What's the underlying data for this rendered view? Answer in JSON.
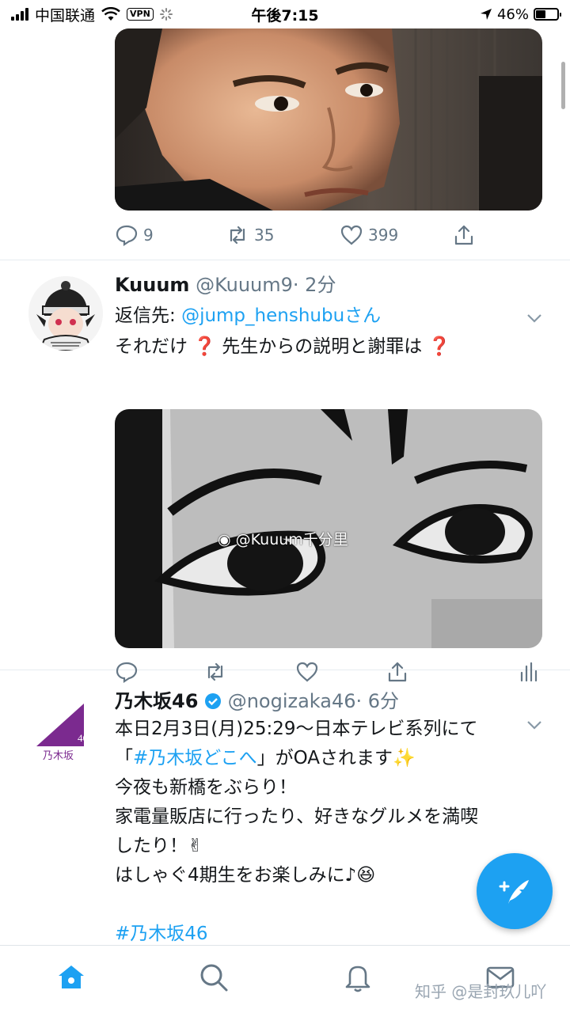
{
  "status_bar": {
    "carrier": "中国联通",
    "vpn": "VPN",
    "time": "午後7:15",
    "battery": "46%",
    "battery_level": 0.46
  },
  "tweets": [
    {
      "actions": {
        "reply_count": "9",
        "retweet_count": "35",
        "like_count": "399"
      }
    },
    {
      "name": "Kuuum",
      "handle": "@Kuuum9",
      "time": "· 2分",
      "reply_prefix": "返信先: ",
      "reply_to": "@jump_henshubuさん",
      "lines": [
        "それだけ ❓ 先生からの説明と謝罪は ❓"
      ],
      "media_watermark": "@Kuuum千分里"
    },
    {
      "name": "乃木坂46",
      "handle": "@nogizaka46",
      "time": "· 6分",
      "avatar_text_top": "46",
      "avatar_text_bottom": "乃木坂",
      "lines": [
        "本日2月3日(月)25:29〜日本テレビ系列にて",
        "「",
        "#乃木坂どこへ",
        "」がOAされます✨",
        "今夜も新橋をぶらり！",
        "家電量販店に行ったり、好きなグルメを満喫",
        "したり！✌",
        "はしゃぐ4期生をお楽しみに♪😆",
        "#乃木坂46"
      ]
    }
  ],
  "colors": {
    "accent": "#1da1f2",
    "verified": "#1da1f2",
    "nogizaka_purple": "#7b2a8f"
  },
  "tab_bar": {
    "tabs": [
      "home-icon",
      "search-icon",
      "notifications-icon",
      "messages-icon"
    ]
  },
  "watermark": "知乎 @是封玖儿吖"
}
